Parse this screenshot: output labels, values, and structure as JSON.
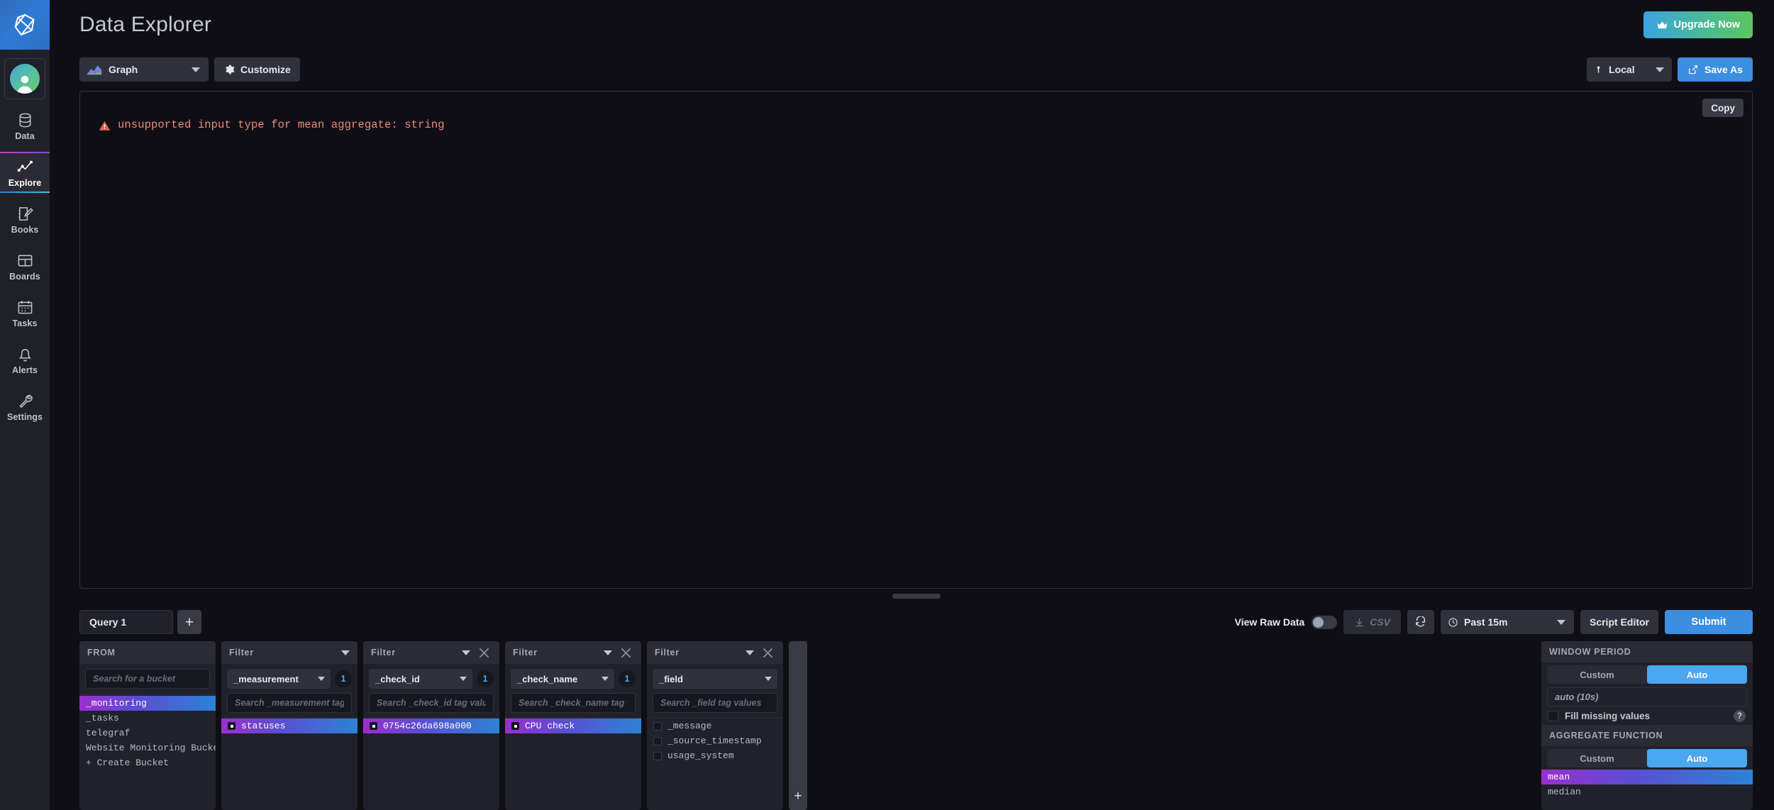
{
  "sidebar": {
    "logo": "influxdb-logo",
    "avatar": "user-avatar",
    "items": [
      {
        "label": "Data",
        "icon": "database-icon",
        "active": false
      },
      {
        "label": "Explore",
        "icon": "explore-icon",
        "active": true
      },
      {
        "label": "Books",
        "icon": "notebook-icon",
        "active": false
      },
      {
        "label": "Boards",
        "icon": "dashboard-icon",
        "active": false
      },
      {
        "label": "Tasks",
        "icon": "calendar-icon",
        "active": false
      },
      {
        "label": "Alerts",
        "icon": "bell-icon",
        "active": false
      },
      {
        "label": "Settings",
        "icon": "wrench-icon",
        "active": false
      }
    ]
  },
  "header": {
    "title": "Data Explorer",
    "upgrade_label": "Upgrade Now",
    "upgrade_icon": "crown-icon"
  },
  "toolbar": {
    "viz_type": "Graph",
    "viz_icon": "graph-icon",
    "customize_label": "Customize",
    "customize_icon": "gear-icon",
    "timezone": "Local",
    "timezone_icon": "pin-icon",
    "save_as_label": "Save As",
    "save_as_icon": "external-link-icon"
  },
  "graph_panel": {
    "copy_label": "Copy",
    "error_icon": "warning-triangle-icon",
    "error_message": "unsupported input type for mean aggregate: string"
  },
  "query_bar": {
    "query_tab": "Query 1",
    "add_query_label": "+",
    "view_raw_label": "View Raw Data",
    "view_raw_on": false,
    "csv_label": "CSV",
    "csv_icon": "download-icon",
    "refresh_icon": "refresh-icon",
    "time_range": "Past 15m",
    "time_icon": "clock-icon",
    "script_editor_label": "Script Editor",
    "submit_label": "Submit"
  },
  "builder": {
    "from": {
      "title": "FROM",
      "search_placeholder": "Search for a bucket",
      "search_value": "",
      "buckets": [
        {
          "label": "_monitoring",
          "selected": true
        },
        {
          "label": "_tasks",
          "selected": false
        },
        {
          "label": "telegraf",
          "selected": false
        },
        {
          "label": "Website Monitoring Bucket",
          "selected": false
        },
        {
          "label": "+ Create Bucket",
          "selected": false
        }
      ]
    },
    "filters": [
      {
        "title": "Filter",
        "key": "_measurement",
        "count": "1",
        "closable": false,
        "search_placeholder": "Search _measurement tag values",
        "search_value": "",
        "values": [
          {
            "label": "statuses",
            "selected": true
          }
        ]
      },
      {
        "title": "Filter",
        "key": "_check_id",
        "count": "1",
        "closable": true,
        "search_placeholder": "Search _check_id tag values",
        "search_value": "",
        "values": [
          {
            "label": "0754c26da698a000",
            "selected": true
          }
        ]
      },
      {
        "title": "Filter",
        "key": "_check_name",
        "count": "1",
        "closable": true,
        "search_placeholder": "Search _check_name tag values",
        "search_value": "",
        "values": [
          {
            "label": "CPU check",
            "selected": true
          }
        ]
      },
      {
        "title": "Filter",
        "key": "_field",
        "count": "",
        "closable": true,
        "search_placeholder": "Search _field tag values",
        "search_value": "",
        "values": [
          {
            "label": "_message",
            "selected": false
          },
          {
            "label": "_source_timestamp",
            "selected": false
          },
          {
            "label": "usage_system",
            "selected": false
          }
        ]
      }
    ],
    "add_filter_label": "+"
  },
  "options": {
    "window_period_title": "WINDOW PERIOD",
    "window_custom_label": "Custom",
    "window_auto_label": "Auto",
    "window_mode": "Auto",
    "window_value": "auto (10s)",
    "fill_missing_label": "Fill missing values",
    "fill_missing_checked": false,
    "help_label": "?",
    "aggregate_title": "AGGREGATE FUNCTION",
    "aggregate_custom_label": "Custom",
    "aggregate_auto_label": "Auto",
    "aggregate_mode": "Auto",
    "functions": [
      {
        "label": "mean",
        "selected": true
      },
      {
        "label": "median",
        "selected": false
      }
    ]
  },
  "colors": {
    "accent_blue": "#3b8ee0",
    "badge_blue": "#4aa7f0",
    "error_salmon": "#ee8b7b",
    "gradient_purple": "#9b2fce",
    "gradient_blue": "#2c83d6",
    "page_bg": "#0f0e15",
    "panel_bg": "#21212b"
  }
}
